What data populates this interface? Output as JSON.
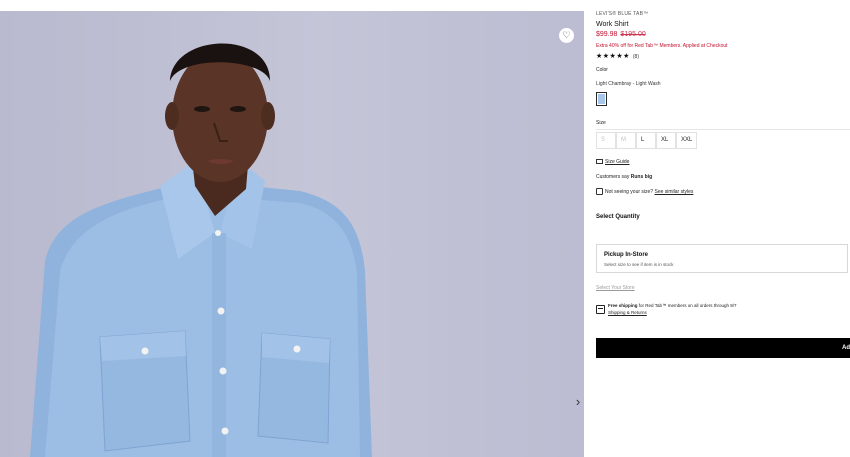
{
  "product": {
    "brand": "LEVI'S® BLUE TAB™",
    "title": "Work Shirt",
    "price_sale": "$99.98",
    "price_original": "$195.00",
    "promo": "Extra 40% off for Red Tab™ Members. Applied at Checkout",
    "rating_stars": "★★★★★",
    "rating_value": 5,
    "rating_count": "(8)"
  },
  "color": {
    "label": "Color",
    "selected_name": "Light Chambray - Light Wash",
    "swatch_hex": "#a8c6ea"
  },
  "size": {
    "label": "Size",
    "options": [
      {
        "label": "S",
        "available": false
      },
      {
        "label": "M",
        "available": false
      },
      {
        "label": "L",
        "available": true
      },
      {
        "label": "XL",
        "available": true
      },
      {
        "label": "XXL",
        "available": true
      }
    ],
    "guide_link": "Size Guide"
  },
  "fit_note": {
    "prefix": "Customers say",
    "value": "Runs big"
  },
  "similar": {
    "text": "Not seeing your size?",
    "link": "See similar styles"
  },
  "quantity": {
    "label": "Select Quantity"
  },
  "pickup": {
    "title": "Pickup In-Store",
    "subtitle": "Select size to see if item is in stock"
  },
  "store": {
    "link": "Select Your Store"
  },
  "shipping": {
    "bold": "Free shipping",
    "text": " for Red Tab™ members on all orders through 9/7",
    "link": "Shipping & Returns"
  },
  "cta": {
    "label": "Ad"
  },
  "icons": {
    "wishlist": "heart-icon",
    "next": "chevron-right-icon",
    "size_guide": "ruler-icon",
    "similar": "hanger-icon",
    "shipping": "truck-icon"
  },
  "colors": {
    "sale_red": "#c41230",
    "button_black": "#000000"
  }
}
